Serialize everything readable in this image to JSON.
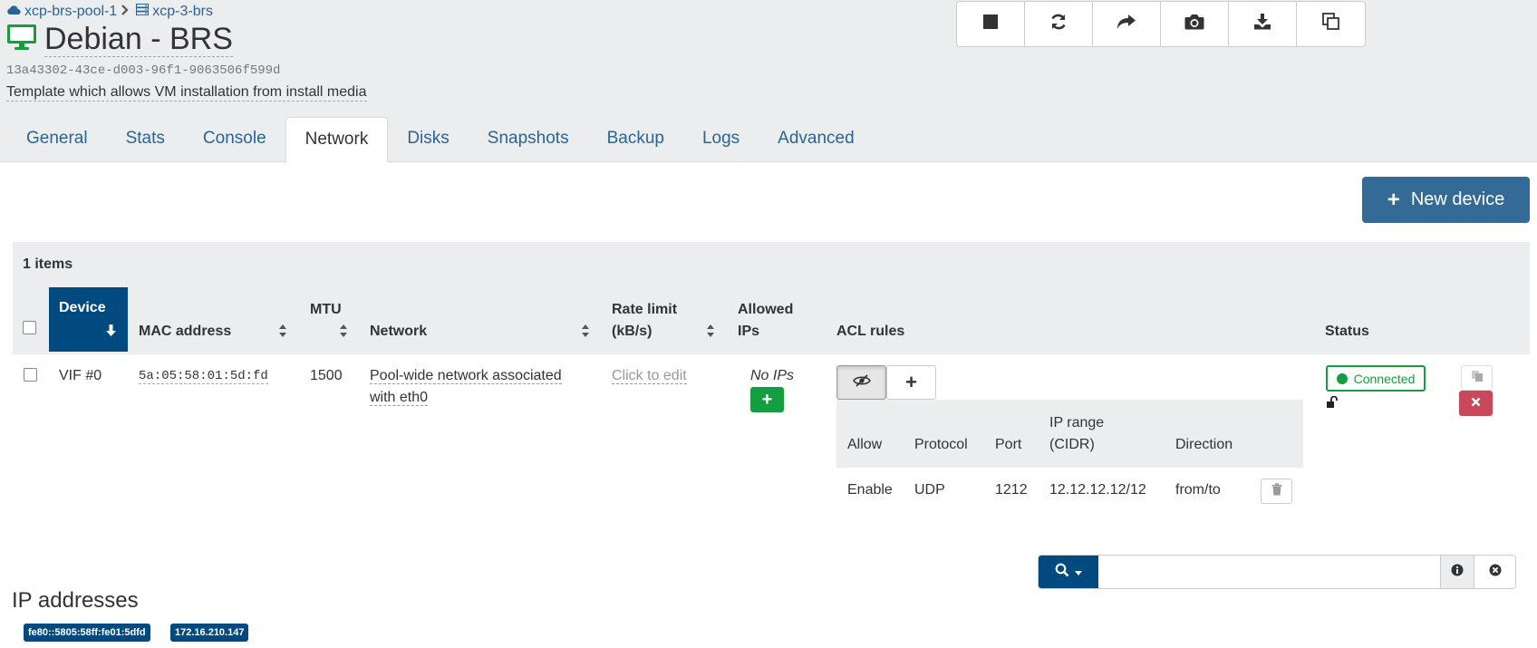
{
  "breadcrumb": {
    "pool": "xcp-brs-pool-1",
    "host": "xcp-3-brs"
  },
  "vm": {
    "name": "Debian - BRS",
    "uuid": "13a43302-43ce-d003-96f1-9063506f599d",
    "description": "Template which allows VM installation from install media"
  },
  "tabs": [
    "General",
    "Stats",
    "Console",
    "Network",
    "Disks",
    "Snapshots",
    "Backup",
    "Logs",
    "Advanced"
  ],
  "active_tab": "Network",
  "new_device_label": "New device",
  "table": {
    "count": "1 items",
    "headers": {
      "device": "Device",
      "mac": "MAC address",
      "mtu": "MTU",
      "network": "Network",
      "rate_1": "Rate limit",
      "rate_2": "(kB/s)",
      "ips_1": "Allowed",
      "ips_2": "IPs",
      "acl": "ACL rules",
      "status": "Status"
    },
    "row": {
      "device": "VIF #0",
      "mac": "5a:05:58:01:5d:fd",
      "mtu": "1500",
      "network_1": "Pool-wide network associated",
      "network_2": "with eth0",
      "rate": "Click to edit",
      "ips": "No IPs",
      "status": "Connected"
    }
  },
  "acl": {
    "headers": {
      "allow": "Allow",
      "protocol": "Protocol",
      "port": "Port",
      "range_1": "IP range",
      "range_2": "(CIDR)",
      "direction": "Direction"
    },
    "rule": {
      "allow": "Enable",
      "protocol": "UDP",
      "port": "1212",
      "range": "12.12.12.12/12",
      "direction": "from/to"
    }
  },
  "search": {
    "value": ""
  },
  "ip_section": {
    "title": "IP addresses",
    "ips": [
      "fe80::5805:58ff:fe01:5dfd",
      "172.16.210.147"
    ]
  },
  "colors": {
    "primary": "#336b96",
    "dark_blue": "#004a80",
    "success": "#149e3e",
    "danger": "#c9495b",
    "header_bg": "#ecedee"
  },
  "icons": [
    "cloud-icon",
    "server-icon",
    "monitor-icon",
    "stop-icon",
    "restart-icon",
    "migrate-icon",
    "snapshot-icon",
    "export-icon",
    "copy-icon",
    "search-icon",
    "info-icon",
    "clear-icon",
    "lock-open-icon",
    "trash-icon"
  ]
}
